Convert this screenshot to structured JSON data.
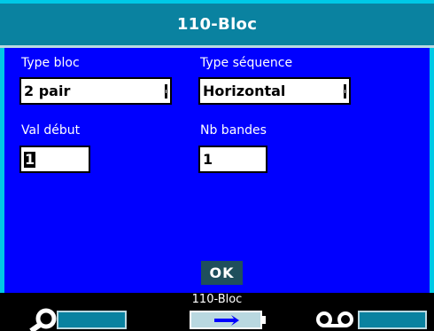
{
  "window": {
    "title": "110-Bloc"
  },
  "form": {
    "type_bloc": {
      "label": "Type bloc",
      "value": "2 pair"
    },
    "type_sequence": {
      "label": "Type séquence",
      "value": "Horizontal"
    },
    "val_debut": {
      "label": "Val début",
      "value": "1"
    },
    "nb_bandes": {
      "label": "Nb bandes",
      "value": "1"
    }
  },
  "actions": {
    "ok_label": "OK"
  },
  "status": {
    "label": "110-Bloc",
    "icons": [
      "magnifier-icon",
      "power-plug-icon",
      "tape-reel-icon"
    ]
  },
  "colors": {
    "background": "#0000ff",
    "title_bar": "#0a82a0",
    "frame": "#00c8e6",
    "ok_button": "#1f4f5c"
  }
}
